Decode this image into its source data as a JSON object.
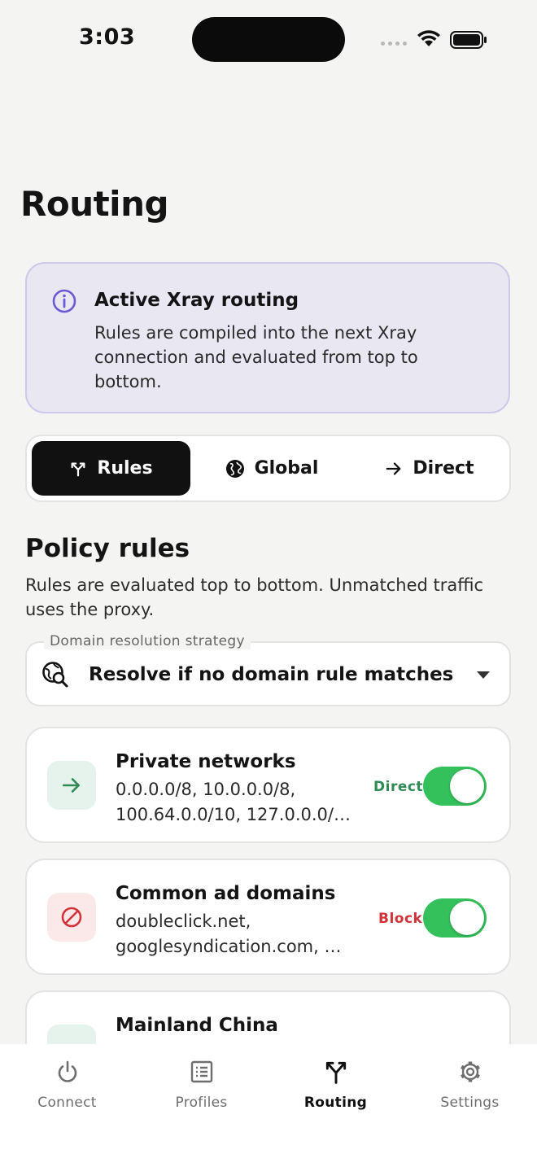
{
  "status_bar": {
    "time": "3:03"
  },
  "page": {
    "title": "Routing"
  },
  "info_card": {
    "title": "Active Xray routing",
    "text": "Rules are compiled into the next Xray connection and evaluated from top to bottom.",
    "icon": "info-circle-icon",
    "accent": "#6b5bd2"
  },
  "mode_selector": {
    "options": [
      {
        "label": "Rules",
        "icon": "routing-icon",
        "selected": true
      },
      {
        "label": "Global",
        "icon": "globe-icon",
        "selected": false
      },
      {
        "label": "Direct",
        "icon": "arrow-right-icon",
        "selected": false
      }
    ]
  },
  "policy": {
    "title": "Policy rules",
    "subtitle": "Rules are evaluated top to bottom. Unmatched traffic uses the proxy."
  },
  "domain_strategy": {
    "label": "Domain resolution strategy",
    "value": "Resolve if no domain rule matches",
    "icon": "dns-search-icon"
  },
  "rules": [
    {
      "title": "Private networks",
      "description": "0.0.0.0/8, 10.0.0.0/8, 100.64.0.0/10, 127.0.0.0/…",
      "action": "Direct",
      "action_color": "#2f8a55",
      "icon": "arrow-right-icon",
      "icon_bg": "#e6f2ec",
      "enabled": true
    },
    {
      "title": "Common ad domains",
      "description": "doubleclick.net, googlesyndication.com, …",
      "action": "Block",
      "action_color": "#d2333a",
      "icon": "block-icon",
      "icon_bg": "#fbe9e9",
      "enabled": true
    },
    {
      "title": "Mainland China",
      "enabled": true
    }
  ],
  "bottom_nav": [
    {
      "label": "Connect",
      "icon": "power-icon",
      "active": false
    },
    {
      "label": "Profiles",
      "icon": "list-icon",
      "active": false
    },
    {
      "label": "Routing",
      "icon": "routing-icon",
      "active": true
    },
    {
      "label": "Settings",
      "icon": "gear-icon",
      "active": false
    }
  ]
}
